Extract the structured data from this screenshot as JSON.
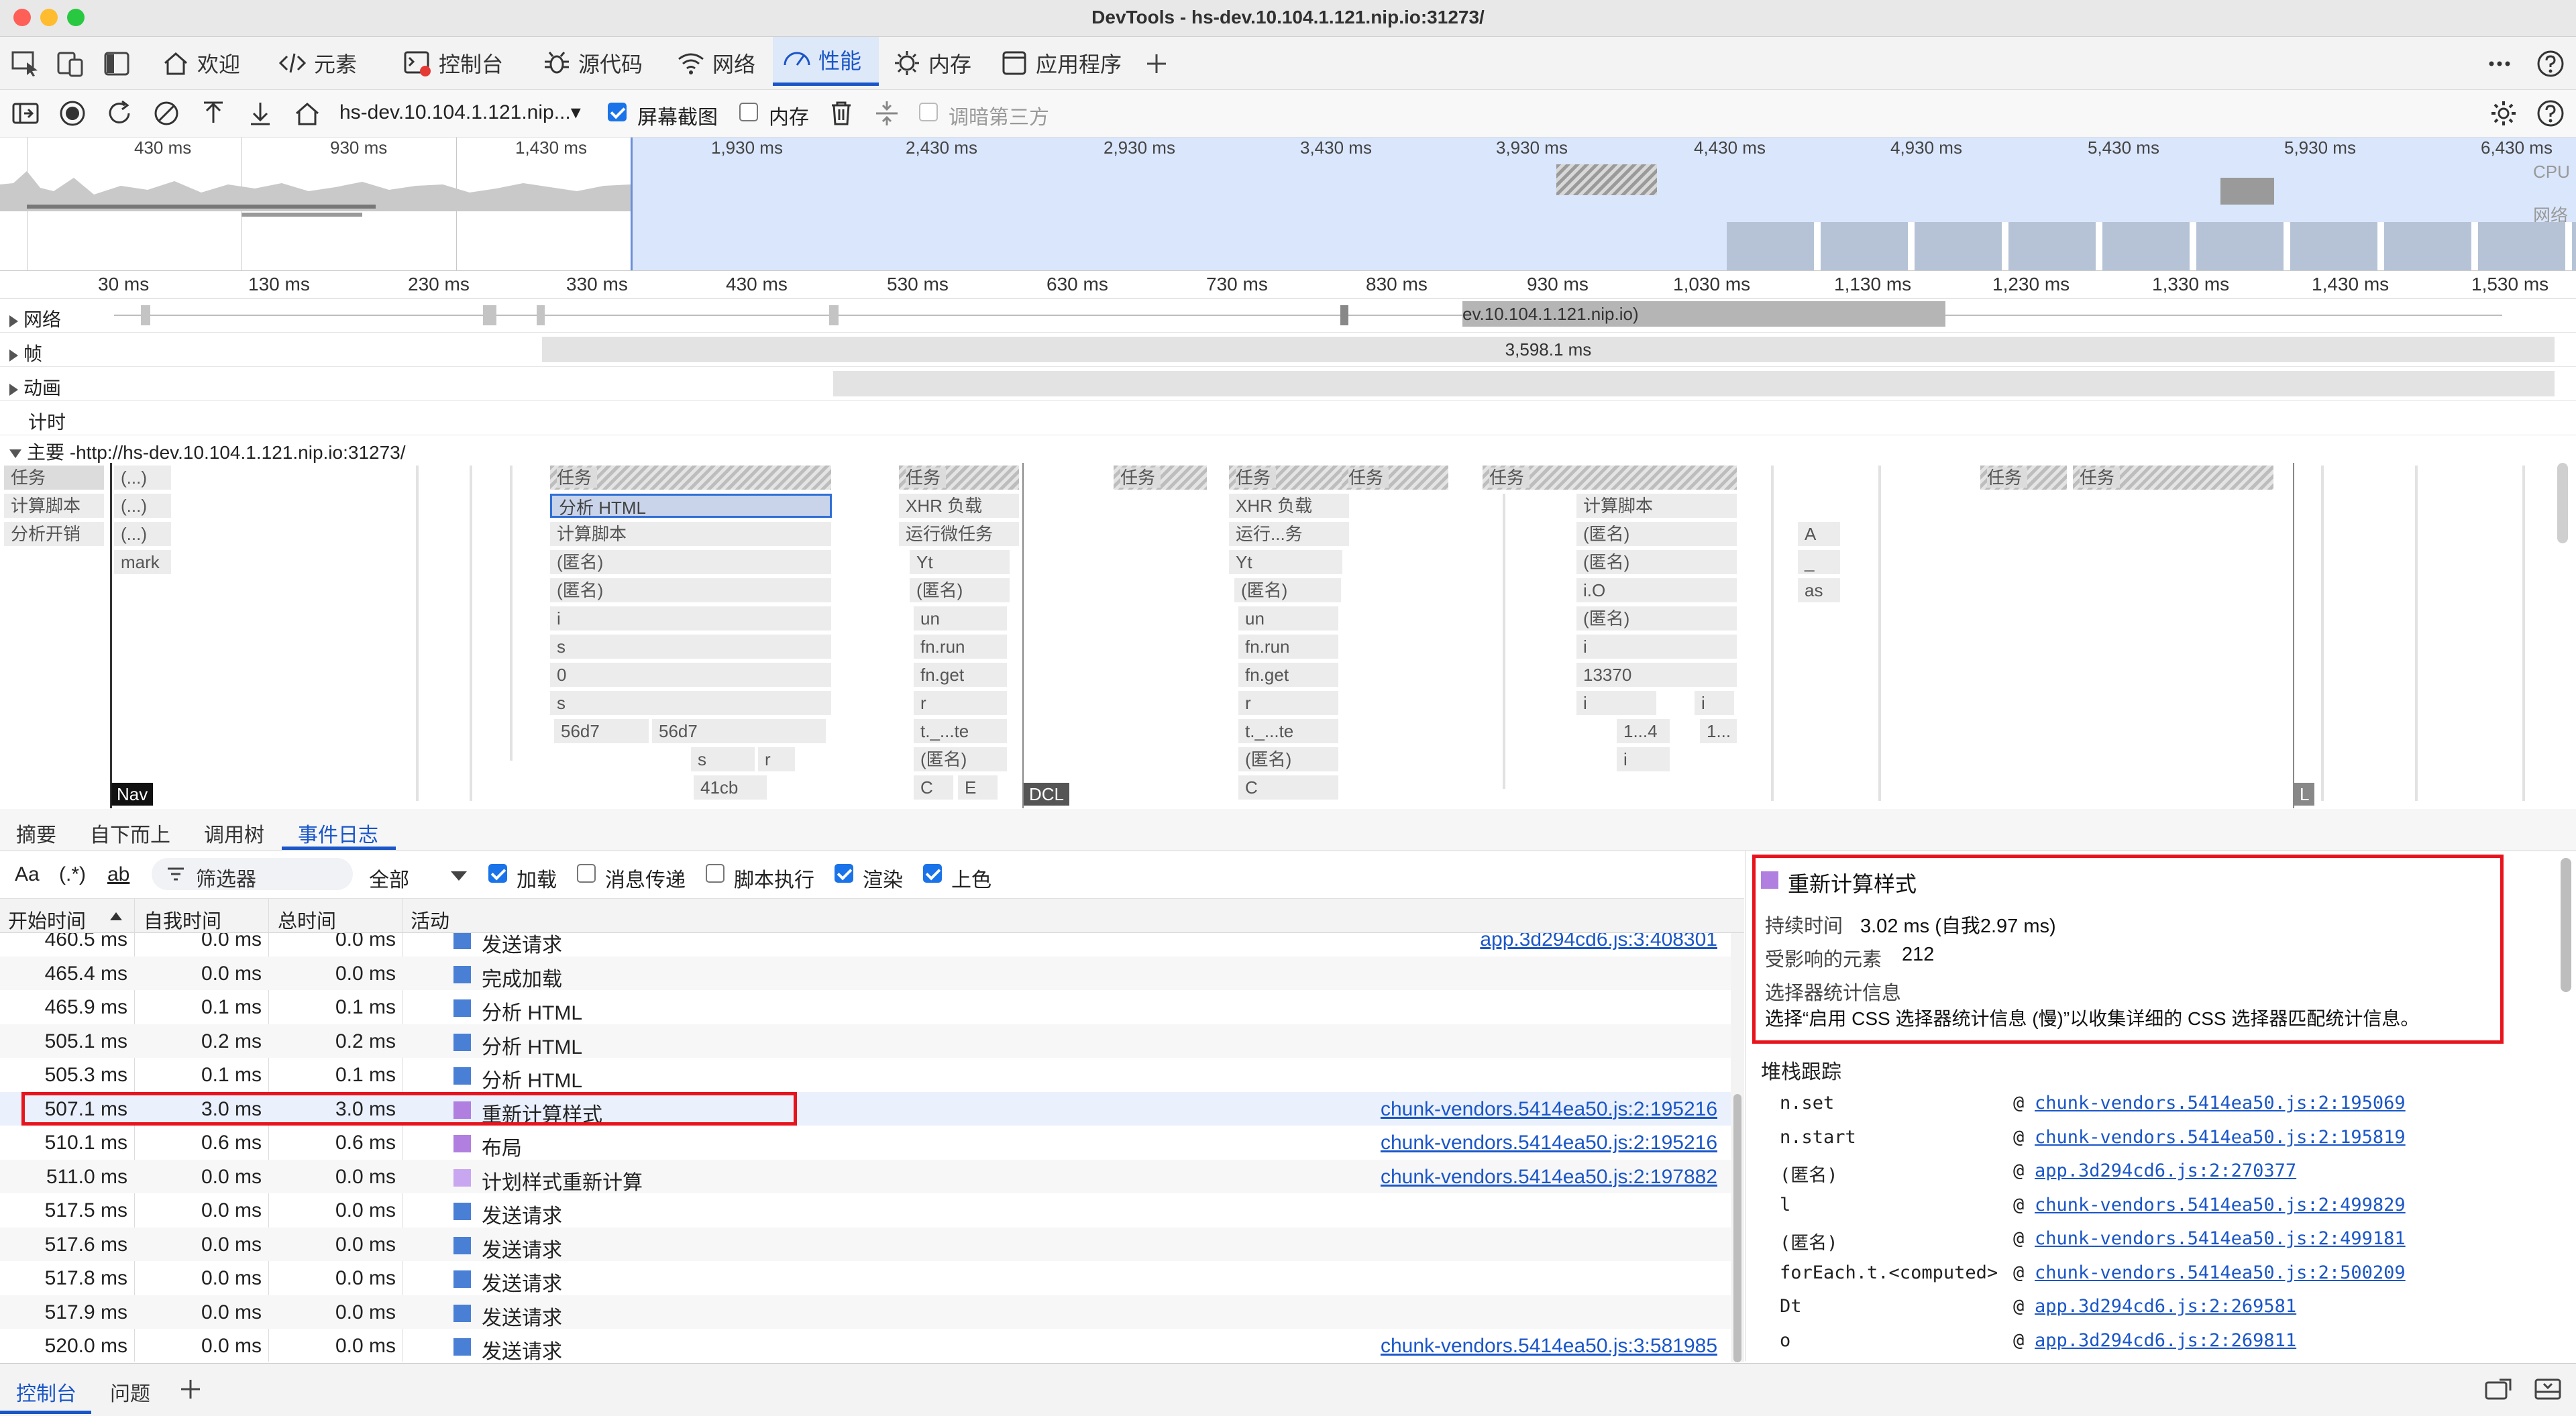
{
  "window": {
    "title": "DevTools - hs-dev.10.104.1.121.nip.io:31273/"
  },
  "main_tabs": [
    {
      "label": "欢迎",
      "icon": "home-icon"
    },
    {
      "label": "元素",
      "icon": "code-icon"
    },
    {
      "label": "控制台",
      "icon": "console-icon"
    },
    {
      "label": "源代码",
      "icon": "bug-icon"
    },
    {
      "label": "网络",
      "icon": "wifi-icon"
    },
    {
      "label": "性能",
      "icon": "performance-icon",
      "active": true
    },
    {
      "label": "内存",
      "icon": "memory-chip-icon"
    },
    {
      "label": "应用程序",
      "icon": "application-icon"
    }
  ],
  "perf_toolbar": {
    "profile_select": "hs-dev.10.104.1.121.nip...▾",
    "screenshots_label": "屏幕截图",
    "screenshots_checked": true,
    "memory_label": "内存",
    "memory_checked": false,
    "third_party_label": "调暗第三方",
    "third_party_checked": false
  },
  "overview": {
    "left_ticks": [
      "430 ms",
      "930 ms",
      "1,430 ms"
    ],
    "right_ticks": [
      "1,930 ms",
      "2,430 ms",
      "2,930 ms",
      "3,430 ms",
      "3,930 ms",
      "4,430 ms",
      "4,930 ms",
      "5,430 ms",
      "5,930 ms",
      "6,430 ms"
    ],
    "cpu_label": "CPU",
    "net_label": "网络"
  },
  "ruler": [
    "30 ms",
    "130 ms",
    "230 ms",
    "330 ms",
    "430 ms",
    "530 ms",
    "630 ms",
    "730 ms",
    "830 ms",
    "930 ms",
    "1,030 ms",
    "1,130 ms",
    "1,230 ms",
    "1,330 ms",
    "1,430 ms",
    "1,530 ms"
  ],
  "tracks": {
    "network": "网络",
    "network_bar": "ev.10.104.1.121.nip.io)",
    "frames": "帧",
    "frames_bar": "3,598.1 ms",
    "animations": "动画",
    "timings": "计时",
    "main": "主要 -http://hs-dev.10.104.1.121.nip.io:31273/"
  },
  "flame": {
    "left_labels": [
      "任务",
      "计算脚本",
      "分析开销"
    ],
    "dots": [
      "(...)",
      "(...)",
      "(...)",
      "mark"
    ],
    "col1": [
      "任务",
      "分析 HTML",
      "计算脚本",
      "(匿名)",
      "(匿名)",
      "i",
      "s",
      "0",
      "s",
      "56d7",
      "56d7",
      "s",
      "r",
      "41cb"
    ],
    "col2": [
      "任务",
      "XHR 负载",
      "运行微任务",
      "Yt",
      "(匿名)",
      "un",
      "fn.run",
      "fn.get",
      "r",
      "t._...te",
      "(匿名)",
      "C",
      "E"
    ],
    "col3": [
      "任务"
    ],
    "col4": [
      "任务",
      "XHR 负载",
      "运行...务",
      "Yt",
      "(匿名)",
      "un",
      "fn.run",
      "fn.get",
      "r",
      "t._...te",
      "(匿名)",
      "C"
    ],
    "col5": [
      "任务",
      "任务",
      "计算脚本",
      "(匿名)",
      "(匿名)",
      "i.O",
      "(匿名)",
      "i",
      "13370",
      "i",
      "i",
      "1...4",
      "1...",
      "i"
    ],
    "col6": [
      "A",
      "_",
      "as"
    ],
    "col7": [
      "任务",
      "任务"
    ],
    "markers": [
      "Nav",
      "DCL",
      "L"
    ]
  },
  "bottom_tabs": [
    "摘要",
    "自下而上",
    "调用树",
    "事件日志"
  ],
  "filter_bar": {
    "aa": "Aa",
    "regex": "(.*)",
    "whole_word": "ab",
    "filter_placeholder": "筛选器",
    "all_select": "全部",
    "checks": [
      {
        "label": "加载",
        "checked": true
      },
      {
        "label": "消息传递",
        "checked": false
      },
      {
        "label": "脚本执行",
        "checked": false
      },
      {
        "label": "渲染",
        "checked": true
      },
      {
        "label": "上色",
        "checked": true
      }
    ]
  },
  "table": {
    "headers": [
      "开始时间",
      "自我时间",
      "总时间",
      "活动"
    ],
    "rows": [
      {
        "start": "460.5 ms",
        "self": "0.0 ms",
        "total": "0.0 ms",
        "color": "#4a7fd6",
        "activity": "发送请求",
        "link": "app.3d294cd6.js:3:408301"
      },
      {
        "start": "465.4 ms",
        "self": "0.0 ms",
        "total": "0.0 ms",
        "color": "#4a7fd6",
        "activity": "完成加载",
        "link": ""
      },
      {
        "start": "465.9 ms",
        "self": "0.1 ms",
        "total": "0.1 ms",
        "color": "#4a7fd6",
        "activity": "分析 HTML",
        "link": ""
      },
      {
        "start": "505.1 ms",
        "self": "0.2 ms",
        "total": "0.2 ms",
        "color": "#4a7fd6",
        "activity": "分析 HTML",
        "link": ""
      },
      {
        "start": "505.3 ms",
        "self": "0.1 ms",
        "total": "0.1 ms",
        "color": "#4a7fd6",
        "activity": "分析 HTML",
        "link": ""
      },
      {
        "start": "507.1 ms",
        "self": "3.0 ms",
        "total": "3.0 ms",
        "color": "#b17fe0",
        "activity": "重新计算样式",
        "link": "chunk-vendors.5414ea50.js:2:195216",
        "highlight": true
      },
      {
        "start": "510.1 ms",
        "self": "0.6 ms",
        "total": "0.6 ms",
        "color": "#b17fe0",
        "activity": "布局",
        "link": "chunk-vendors.5414ea50.js:2:195216"
      },
      {
        "start": "511.0 ms",
        "self": "0.0 ms",
        "total": "0.0 ms",
        "color": "#c9a6f0",
        "activity": "计划样式重新计算",
        "link": "chunk-vendors.5414ea50.js:2:197882"
      },
      {
        "start": "517.5 ms",
        "self": "0.0 ms",
        "total": "0.0 ms",
        "color": "#4a7fd6",
        "activity": "发送请求",
        "link": ""
      },
      {
        "start": "517.6 ms",
        "self": "0.0 ms",
        "total": "0.0 ms",
        "color": "#4a7fd6",
        "activity": "发送请求",
        "link": ""
      },
      {
        "start": "517.8 ms",
        "self": "0.0 ms",
        "total": "0.0 ms",
        "color": "#4a7fd6",
        "activity": "发送请求",
        "link": ""
      },
      {
        "start": "517.9 ms",
        "self": "0.0 ms",
        "total": "0.0 ms",
        "color": "#4a7fd6",
        "activity": "发送请求",
        "link": ""
      },
      {
        "start": "520.0 ms",
        "self": "0.0 ms",
        "total": "0.0 ms",
        "color": "#4a7fd6",
        "activity": "发送请求",
        "link": "chunk-vendors.5414ea50.js:3:581985"
      }
    ]
  },
  "details": {
    "title": "重新计算样式",
    "title_color": "#b17fe0",
    "duration_label": "持续时间",
    "duration_value": "3.02 ms (自我2.97 ms)",
    "affected_label": "受影响的元素",
    "affected_value": "212",
    "selector_label": "选择器统计信息",
    "selector_text": "选择“启用 CSS 选择器统计信息 (慢)”以收集详细的 CSS 选择器匹配统计信息。",
    "stack_title": "堆栈跟踪",
    "stack": [
      {
        "fn": "n.set",
        "link": "chunk-vendors.5414ea50.js:2:195069"
      },
      {
        "fn": "n.start",
        "link": "chunk-vendors.5414ea50.js:2:195819"
      },
      {
        "fn": "(匿名)",
        "link": "app.3d294cd6.js:2:270377"
      },
      {
        "fn": "l",
        "link": "chunk-vendors.5414ea50.js:2:499829"
      },
      {
        "fn": "(匿名)",
        "link": "chunk-vendors.5414ea50.js:2:499181"
      },
      {
        "fn": "forEach.t.<computed>",
        "link": "chunk-vendors.5414ea50.js:2:500209"
      },
      {
        "fn": "Dt",
        "link": "app.3d294cd6.js:2:269581"
      },
      {
        "fn": "o",
        "link": "app.3d294cd6.js:2:269811"
      }
    ]
  },
  "drawer": {
    "tabs": [
      "控制台",
      "问题"
    ]
  }
}
